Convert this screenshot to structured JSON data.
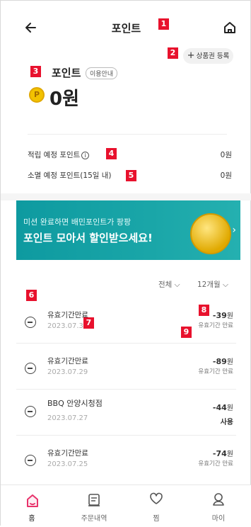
{
  "header": {
    "title": "포인트"
  },
  "badges": [
    "1",
    "2",
    "3",
    "4",
    "5",
    "6",
    "7",
    "8",
    "9"
  ],
  "register_label": "상품권 등록",
  "points": {
    "label": "포인트",
    "usage_guide": "이용안내",
    "amount": "0원"
  },
  "accrual": {
    "label": "적립 예정 포인트",
    "value": "0원"
  },
  "expiry": {
    "label": "소멸 예정 포인트(15일 내)",
    "value": "0원"
  },
  "banner": {
    "line1": "미션 완료하면 배민포인트가 팡팡",
    "line2": "포인트 모아서 할인받으세요!"
  },
  "filters": {
    "type": "전체",
    "period": "12개월"
  },
  "history": [
    {
      "name": "유효기간만료",
      "date": "2023.07.31",
      "amount": "-39",
      "unit": "원",
      "status": "유효기간 만료"
    },
    {
      "name": "유효기간만료",
      "date": "2023.07.29",
      "amount": "-89",
      "unit": "원",
      "status": "유효기간 만료"
    },
    {
      "name": "BBQ 안양시청점",
      "date": "2023.07.27",
      "amount": "-44",
      "unit": "원",
      "status": "사용"
    },
    {
      "name": "유효기간만료",
      "date": "2023.07.25",
      "amount": "-74",
      "unit": "원",
      "status": "유효기간 만료"
    }
  ],
  "tabs": [
    {
      "label": "홈",
      "icon": "home-icon"
    },
    {
      "label": "주문내역",
      "icon": "receipt-icon"
    },
    {
      "label": "찜",
      "icon": "heart-icon"
    },
    {
      "label": "마이",
      "icon": "user-icon"
    }
  ],
  "colors": {
    "badge": "#e8112d",
    "accent": "#e8336b",
    "banner": "#1aa6a8",
    "coin": "#f2c200"
  }
}
